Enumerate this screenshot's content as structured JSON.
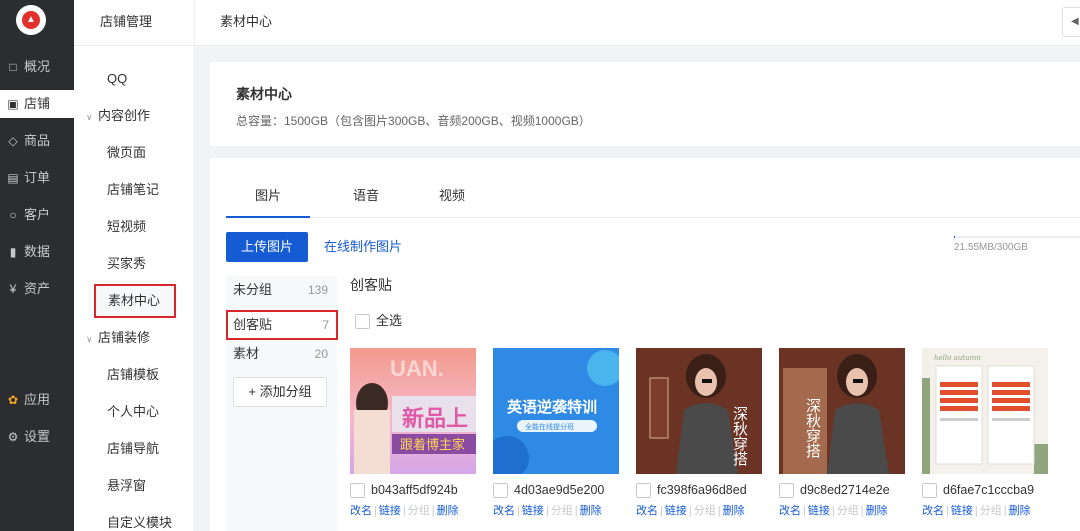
{
  "nav": {
    "items": [
      {
        "label": "概况",
        "icon": "overview-icon"
      },
      {
        "label": "店铺",
        "icon": "shop-icon"
      },
      {
        "label": "商品",
        "icon": "tag-icon"
      },
      {
        "label": "订单",
        "icon": "order-icon"
      },
      {
        "label": "客户",
        "icon": "customer-icon"
      },
      {
        "label": "数据",
        "icon": "chart-icon"
      },
      {
        "label": "资产",
        "icon": "yen-icon"
      }
    ],
    "bottom": [
      {
        "label": "应用",
        "icon": "apps-icon"
      },
      {
        "label": "设置",
        "icon": "gear-icon"
      }
    ],
    "active_index": 1
  },
  "subnav": {
    "title": "店铺管理",
    "items": {
      "qq": "QQ",
      "content_group": "内容创作",
      "micro_page": "微页面",
      "notes": "店铺笔记",
      "short_video": "短视频",
      "buyer_show": "买家秀",
      "material": "素材中心",
      "deco_group": "店铺装修",
      "template": "店铺模板",
      "personal": "个人中心",
      "navigation": "店铺导航",
      "float_window": "悬浮窗",
      "custom_module": "自定义模块"
    }
  },
  "header": {
    "breadcrumb": "素材中心"
  },
  "info": {
    "title": "素材中心",
    "capacity": "总容量：1500GB（包含图片300GB、音频200GB、视频1000GB）"
  },
  "tabs": [
    "图片",
    "语音",
    "视频"
  ],
  "toolbar": {
    "upload": "上传图片",
    "online": "在线制作图片",
    "storage": "21.55MB/300GB",
    "storage_fraction": 0.0001
  },
  "groups": [
    {
      "name": "未分组",
      "count": "139"
    },
    {
      "name": "创客贴",
      "count": "7"
    },
    {
      "name": "素材",
      "count": "20"
    }
  ],
  "add_group": "+ 添加分组",
  "content": {
    "title": "创客贴",
    "select_all": "全选",
    "actions": {
      "rename": "改名",
      "link": "链接",
      "group": "分组",
      "delete": "删除"
    },
    "images": [
      {
        "name": "b043aff5df924b",
        "art_text": "新品上",
        "art_sub": "跟着博主家"
      },
      {
        "name": "4d03ae9d5e200",
        "art_text": "英语逆袭特训",
        "art_sub": "全能在线提分班"
      },
      {
        "name": "fc398f6a96d8ed",
        "art_text": "深秋穿搭"
      },
      {
        "name": "d9c8ed2714e2e",
        "art_text": "深秋穿搭"
      },
      {
        "name": "d6fae7c1cccba9",
        "art_text": "hello autumn"
      }
    ]
  },
  "colors": {
    "brand_blue": "#155bd4",
    "highlight_red": "#d9262a",
    "nav_dark": "#2b2d30"
  }
}
